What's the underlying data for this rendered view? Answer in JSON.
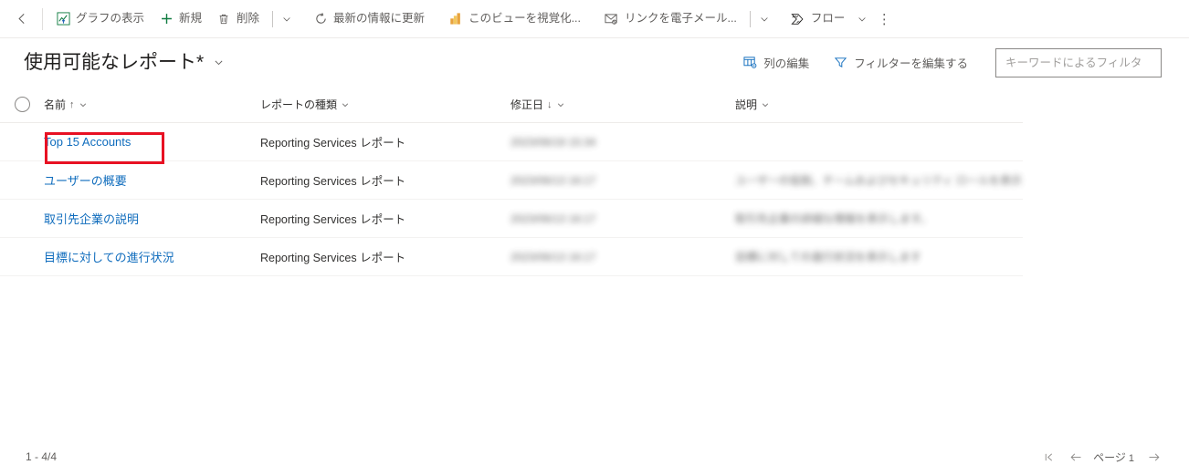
{
  "commandbar": {
    "back_label": "back-arrow",
    "items": [
      {
        "label": "グラフの表示",
        "icon": "chart-icon"
      },
      {
        "label": "新規",
        "icon": "plus-icon"
      },
      {
        "label": "削除",
        "icon": "trash-icon"
      },
      {
        "label": "最新の情報に更新",
        "icon": "refresh-icon"
      },
      {
        "label": "このビューを視覚化...",
        "icon": "powerbi-icon"
      },
      {
        "label": "リンクを電子メール...",
        "icon": "email-link-icon"
      },
      {
        "label": "フロー",
        "icon": "flow-icon"
      }
    ],
    "overflow_label": "⋮"
  },
  "header": {
    "title": "使用可能なレポート*",
    "edit_columns": "列の編集",
    "edit_filters": "フィルターを編集する"
  },
  "search": {
    "placeholder": "キーワードによるフィルタ",
    "value": ""
  },
  "grid": {
    "columns": [
      {
        "label": "名前",
        "sort": "↑"
      },
      {
        "label": "レポートの種類",
        "sort": ""
      },
      {
        "label": "修正日",
        "sort": "↓"
      },
      {
        "label": "説明",
        "sort": ""
      }
    ],
    "rows": [
      {
        "name": "Top 15 Accounts",
        "type": "Reporting Services レポート",
        "modified": "2023/06/19 15:34",
        "description": "",
        "highlighted": true
      },
      {
        "name": "ユーザーの概要",
        "type": "Reporting Services レポート",
        "modified": "2023/06/13 16:17",
        "description": "ユーザーの役割、チームおよびセキュリティ ロールを表示します。",
        "highlighted": false
      },
      {
        "name": "取引先企業の説明",
        "type": "Reporting Services レポート",
        "modified": "2023/06/13 16:17",
        "description": "取引先企業の詳細な情報を表示します。",
        "highlighted": false
      },
      {
        "name": "目標に対しての進行状況",
        "type": "Reporting Services レポート",
        "modified": "2023/06/13 16:17",
        "description": "目標に対しての進行状況を表示します",
        "highlighted": false
      }
    ]
  },
  "footer": {
    "record_count": "1 - 4/4",
    "page_label": "ページ",
    "page_number": "1"
  },
  "colors": {
    "link": "#0f6cbd",
    "annotation": "#e81123",
    "accent_green": "#107c41",
    "powerbi_yellow": "#e8a33d"
  }
}
